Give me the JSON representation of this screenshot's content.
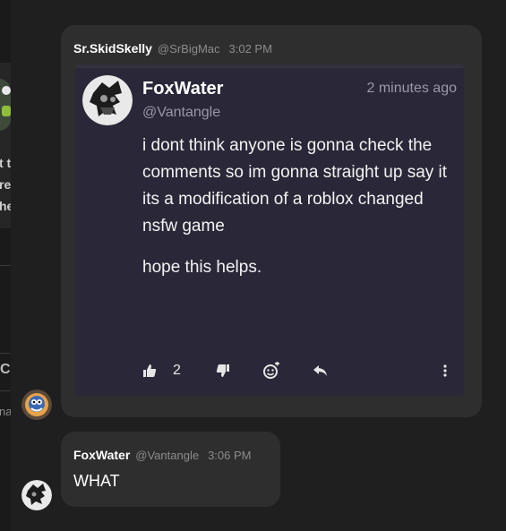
{
  "left_panel": {
    "text_lines": [
      "t t",
      "re",
      "he"
    ],
    "letter": "C",
    "snippet": "na"
  },
  "message1": {
    "username": "Sr.SkidSkelly",
    "handle": "@SrBigMac",
    "time": "3:02 PM"
  },
  "embed": {
    "author_name": "FoxWater",
    "author_handle": "@Vantangle",
    "timestamp": "2 minutes ago",
    "body_paragraphs": [
      "i dont think anyone is gonna check the comments so im gonna straight up say it its a modification of a roblox changed nsfw game",
      "hope this helps."
    ],
    "like_count": "2",
    "actions": [
      "thumbs-up-icon",
      "thumbs-down-icon",
      "add-reaction-icon",
      "reply-icon",
      "more-icon"
    ]
  },
  "message2": {
    "username": "FoxWater",
    "handle": "@Vantangle",
    "time": "3:06 PM",
    "text": "WHAT"
  }
}
